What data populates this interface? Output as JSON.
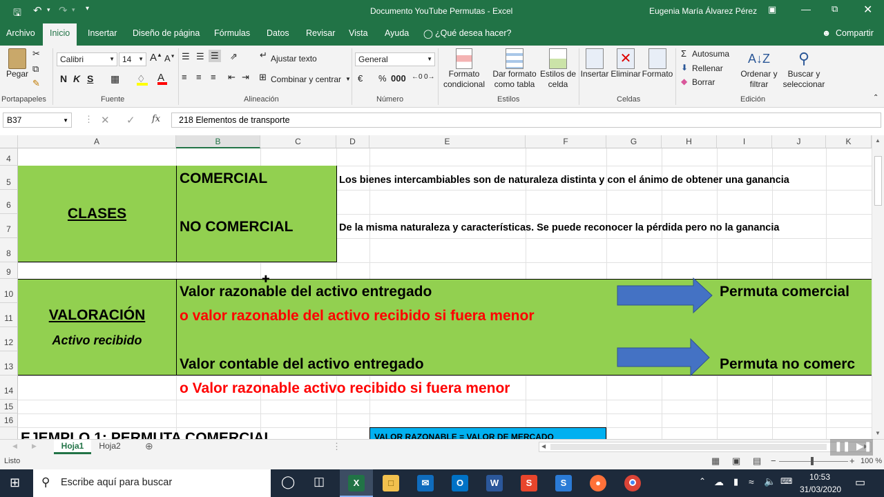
{
  "window": {
    "title": "Documento YouTube Permutas  -  Excel",
    "user": "Eugenia María Álvarez Pérez"
  },
  "ribbon_tabs": [
    "Archivo",
    "Inicio",
    "Insertar",
    "Diseño de página",
    "Fórmulas",
    "Datos",
    "Revisar",
    "Vista",
    "Ayuda"
  ],
  "tell_me": "¿Qué desea hacer?",
  "share": "Compartir",
  "ribbon": {
    "paste": "Pegar",
    "clipboard_group": "Portapapeles",
    "font_name": "Calibri",
    "font_size": "14",
    "font_group": "Fuente",
    "bold": "N",
    "italic": "K",
    "underline": "S",
    "wrap_text": "Ajustar texto",
    "merge": "Combinar y centrar",
    "alignment_group": "Alineación",
    "number_format": "General",
    "number_group": "Número",
    "conditional_format_1": "Formato",
    "conditional_format_2": "condicional",
    "format_table_1": "Dar formato",
    "format_table_2": "como tabla",
    "cell_styles_1": "Estilos de",
    "cell_styles_2": "celda",
    "styles_group": "Estilos",
    "insert": "Insertar",
    "delete": "Eliminar",
    "format": "Formato",
    "cells_group": "Celdas",
    "autosum": "Autosuma",
    "fill": "Rellenar",
    "clear": "Borrar",
    "sort_1": "Ordenar y",
    "sort_2": "filtrar",
    "find_1": "Buscar y",
    "find_2": "seleccionar",
    "editing_group": "Edición"
  },
  "formula_bar": {
    "name_box": "B37",
    "formula": "218 Elementos de transporte"
  },
  "columns": [
    "A",
    "B",
    "C",
    "D",
    "E",
    "F",
    "G",
    "H",
    "I",
    "J",
    "K"
  ],
  "rows": [
    "4",
    "5",
    "6",
    "7",
    "8",
    "9",
    "10",
    "11",
    "12",
    "13",
    "14",
    "15",
    "16"
  ],
  "cells": {
    "clases": "CLASES",
    "comercial": "COMERCIAL",
    "no_comercial": "NO COMERCIAL",
    "comercial_desc": "Los bienes intercambiables son de naturaleza distinta y con el ánimo de obtener una ganancia",
    "no_comercial_desc": "De la misma naturaleza y características. Se puede reconocer la pérdida pero no la ganancia",
    "valoracion": "VALORACIÓN",
    "activo_recibido": "Activo recibido",
    "line1": "Valor razonable del activo entregado",
    "line2": "o valor razonable del activo recibido si fuera menor",
    "line3": "Valor contable del activo entregado",
    "line4": "o Valor razonable  activo recibido si fuera menor",
    "permuta_comercial": "Permuta comercial",
    "permuta_no_comercial": "Permuta no comerc",
    "ejemplo": "EJEMPLO 1: PERMUTA COMERCIAL",
    "valor_box": "VALOR RAZONABLE = VALOR DE MERCADO"
  },
  "sheets": [
    "Hoja1",
    "Hoja2"
  ],
  "status": {
    "ready": "Listo",
    "zoom": "100 %"
  },
  "taskbar": {
    "search_placeholder": "Escribe aquí para buscar",
    "time": "10:53",
    "date": "31/03/2020"
  },
  "colors": {
    "excel_green": "#217346",
    "cell_green": "#92d050",
    "red_text": "#ff0000",
    "arrow_blue": "#4472c4",
    "cyan_box": "#00b0f0"
  }
}
